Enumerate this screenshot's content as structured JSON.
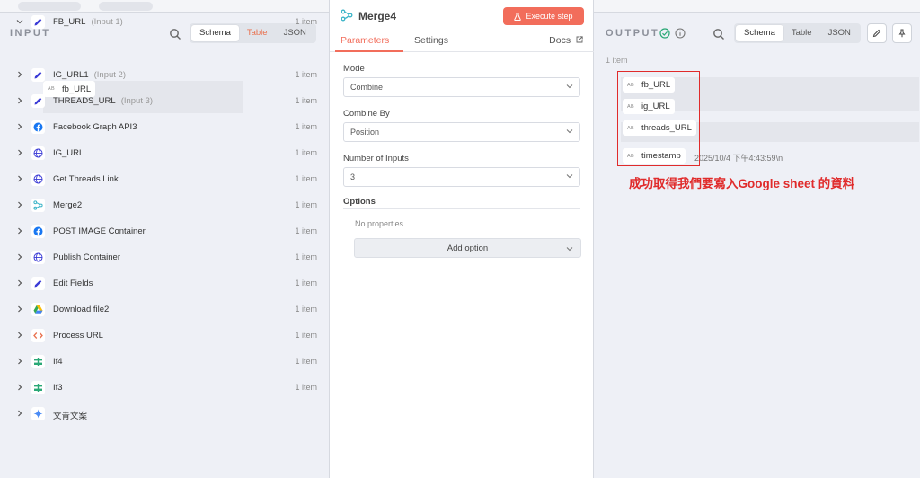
{
  "input": {
    "title": "INPUT",
    "view_options": [
      "Schema",
      "Table",
      "JSON"
    ],
    "field": {
      "type_badge": "AB",
      "name": "fb_URL"
    },
    "nodes": [
      {
        "name": "FB_URL",
        "sub": "(Input 1)",
        "count": "1 item",
        "icon": "pencil-icon",
        "expanded": true
      },
      {
        "name": "IG_URL1",
        "sub": "(Input 2)",
        "count": "1 item",
        "icon": "pencil-icon"
      },
      {
        "name": "THREADS_URL",
        "sub": "(Input 3)",
        "count": "1 item",
        "icon": "pencil-icon"
      },
      {
        "name": "Facebook Graph API3",
        "sub": "",
        "count": "1 item",
        "icon": "facebook-icon"
      },
      {
        "name": "IG_URL",
        "sub": "",
        "count": "1 item",
        "icon": "globe-icon"
      },
      {
        "name": "Get Threads Link",
        "sub": "",
        "count": "1 item",
        "icon": "globe-icon"
      },
      {
        "name": "Merge2",
        "sub": "",
        "count": "1 item",
        "icon": "merge-icon"
      },
      {
        "name": "POST IMAGE Container",
        "sub": "",
        "count": "1 item",
        "icon": "facebook-icon"
      },
      {
        "name": "Publish Container",
        "sub": "",
        "count": "1 item",
        "icon": "globe-icon"
      },
      {
        "name": "Edit Fields",
        "sub": "",
        "count": "1 item",
        "icon": "pencil-icon"
      },
      {
        "name": "Download file2",
        "sub": "",
        "count": "1 item",
        "icon": "google-drive-icon"
      },
      {
        "name": "Process URL",
        "sub": "",
        "count": "1 item",
        "icon": "code-icon"
      },
      {
        "name": "If4",
        "sub": "",
        "count": "1 item",
        "icon": "if-icon"
      },
      {
        "name": "If3",
        "sub": "",
        "count": "1 item",
        "icon": "if-icon"
      },
      {
        "name": "文青文案",
        "sub": "",
        "count": "",
        "icon": "gemini-icon"
      }
    ]
  },
  "node_editor": {
    "title": "Merge4",
    "execute_label": "Execute step",
    "tabs": [
      "Parameters",
      "Settings"
    ],
    "docs_label": "Docs",
    "mode": {
      "label": "Mode",
      "value": "Combine"
    },
    "combine_by": {
      "label": "Combine By",
      "value": "Position"
    },
    "num_inputs": {
      "label": "Number of Inputs",
      "value": "3"
    },
    "options": {
      "label": "Options",
      "empty_text": "No properties",
      "add_label": "Add option"
    }
  },
  "output": {
    "title": "OUTPUT",
    "view_options": [
      "Schema",
      "Table",
      "JSON"
    ],
    "count": "1 item",
    "fields": [
      {
        "type_badge": "AB",
        "name": "fb_URL"
      },
      {
        "type_badge": "AB",
        "name": "ig_URL"
      },
      {
        "type_badge": "AB",
        "name": "threads_URL"
      },
      {
        "type_badge": "AB",
        "name": "timestamp"
      }
    ],
    "timestamp_value": "2025/10/4 下午4:43:59\\n",
    "annotation": "成功取得我們要寫入Google sheet 的資料"
  },
  "colors": {
    "accent": "#f26d5b",
    "annotation": "#e02b2b",
    "success": "#2aa876"
  }
}
